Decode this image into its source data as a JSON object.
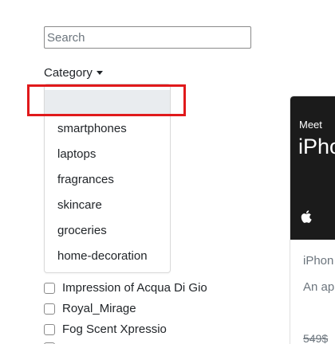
{
  "search": {
    "placeholder": "Search",
    "value": ""
  },
  "category": {
    "label": "Category",
    "options": [
      "",
      "smartphones",
      "laptops",
      "fragrances",
      "skincare",
      "groceries",
      "home-decoration"
    ]
  },
  "products_filter": {
    "items": [
      "Impression of Acqua Di Gio",
      "Royal_Mirage",
      "Fog Scent Xpressio"
    ]
  },
  "product_card": {
    "image_small_text": "Meet",
    "image_big_text": "iPho",
    "title": "iPhon",
    "description": "An ap apple",
    "price": "549$"
  },
  "colors": {
    "highlight": "#e0191b",
    "active_item": "#e9ecef"
  }
}
